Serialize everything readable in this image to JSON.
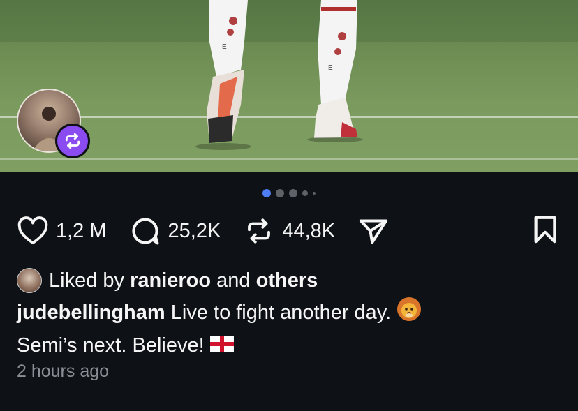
{
  "post": {
    "stats": {
      "likes": "1,2 M",
      "replies": "25,2K",
      "reposts": "44,8K"
    },
    "liked_by": {
      "prefix": "Liked by",
      "user": "ranieroo",
      "connector": "and",
      "others": "others"
    },
    "caption": {
      "author": "judebellingham",
      "line1": "Live to fight another day.",
      "line2": "Semi’s next. Believe!"
    },
    "timestamp": "2 hours ago",
    "carousel": {
      "count": 5,
      "active_index": 0
    }
  },
  "colors": {
    "background": "#0e1116",
    "repost_badge": "#8a4bf0",
    "active_dot": "#4f7df5",
    "muted_text": "#8a8f96"
  },
  "icons": [
    "heart-icon",
    "comment-icon",
    "repost-icon",
    "share-icon",
    "bookmark-icon",
    "lion-emoji",
    "england-flag-emoji"
  ]
}
